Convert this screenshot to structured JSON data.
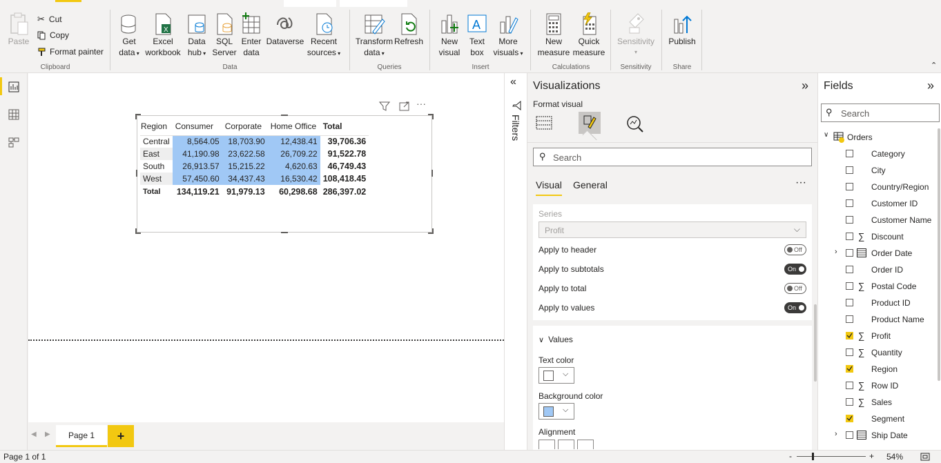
{
  "ribbon": {
    "clipboard": {
      "paste": "Paste",
      "cut": "Cut",
      "copy": "Copy",
      "format_painter": "Format painter",
      "group": "Clipboard"
    },
    "data": {
      "get_data_1": "Get",
      "get_data_2": "data",
      "excel_1": "Excel",
      "excel_2": "workbook",
      "hub_1": "Data",
      "hub_2": "hub",
      "sql_1": "SQL",
      "sql_2": "Server",
      "enter_1": "Enter",
      "enter_2": "data",
      "dataverse": "Dataverse",
      "recent_1": "Recent",
      "recent_2": "sources",
      "group": "Data"
    },
    "queries": {
      "transform_1": "Transform",
      "transform_2": "data",
      "refresh": "Refresh",
      "group": "Queries"
    },
    "insert": {
      "newvis_1": "New",
      "newvis_2": "visual",
      "textbox_1": "Text",
      "textbox_2": "box",
      "more_1": "More",
      "more_2": "visuals",
      "group": "Insert"
    },
    "calc": {
      "newmeasure_1": "New",
      "newmeasure_2": "measure",
      "quick_1": "Quick",
      "quick_2": "measure",
      "group": "Calculations"
    },
    "sensitivity": {
      "label": "Sensitivity",
      "group": "Sensitivity"
    },
    "share": {
      "publish": "Publish",
      "group": "Share"
    }
  },
  "matrix": {
    "headers": [
      "Region",
      "Consumer",
      "Corporate",
      "Home Office",
      "Total"
    ],
    "rows": [
      {
        "region": "Central",
        "consumer": "8,564.05",
        "corporate": "18,703.90",
        "home": "12,438.41",
        "total": "39,706.36"
      },
      {
        "region": "East",
        "consumer": "41,190.98",
        "corporate": "23,622.58",
        "home": "26,709.22",
        "total": "91,522.78"
      },
      {
        "region": "South",
        "consumer": "26,913.57",
        "corporate": "15,215.22",
        "home": "4,620.63",
        "total": "46,749.43"
      },
      {
        "region": "West",
        "consumer": "57,450.60",
        "corporate": "34,437.43",
        "home": "16,530.42",
        "total": "108,418.45"
      }
    ],
    "total_row": {
      "region": "Total",
      "consumer": "134,119.21",
      "corporate": "91,979.13",
      "home": "60,298.68",
      "total": "286,397.02"
    },
    "highlight_color": "#a0c8f5"
  },
  "pages": {
    "page1": "Page 1",
    "add": "+"
  },
  "status": {
    "page_info": "Page 1 of 1",
    "zoom": "54%",
    "zoom_minus": "-",
    "zoom_plus": "+"
  },
  "filters": {
    "label": "Filters"
  },
  "visualizations": {
    "title": "Visualizations",
    "subtitle": "Format visual",
    "search_placeholder": "Search",
    "tabs": [
      "Visual",
      "General"
    ],
    "series_label": "Series",
    "series_value": "Profit",
    "toggles": [
      {
        "label": "Apply to header",
        "state": "Off"
      },
      {
        "label": "Apply to subtotals",
        "state": "On"
      },
      {
        "label": "Apply to total",
        "state": "Off"
      },
      {
        "label": "Apply to values",
        "state": "On"
      }
    ],
    "values_section": "Values",
    "text_color_label": "Text color",
    "bg_color_label": "Background color",
    "alignment_label": "Alignment",
    "text_color": "#ffffff",
    "bg_color": "#a0c8f5"
  },
  "fields": {
    "title": "Fields",
    "search_placeholder": "Search",
    "table_name": "Orders",
    "items": [
      {
        "name": "Category",
        "sigma": false,
        "checked": false,
        "expand": false,
        "calendar": false
      },
      {
        "name": "City",
        "sigma": false,
        "checked": false,
        "expand": false,
        "calendar": false
      },
      {
        "name": "Country/Region",
        "sigma": false,
        "checked": false,
        "expand": false,
        "calendar": false
      },
      {
        "name": "Customer ID",
        "sigma": false,
        "checked": false,
        "expand": false,
        "calendar": false
      },
      {
        "name": "Customer Name",
        "sigma": false,
        "checked": false,
        "expand": false,
        "calendar": false
      },
      {
        "name": "Discount",
        "sigma": true,
        "checked": false,
        "expand": false,
        "calendar": false
      },
      {
        "name": "Order Date",
        "sigma": false,
        "checked": false,
        "expand": true,
        "calendar": true
      },
      {
        "name": "Order ID",
        "sigma": false,
        "checked": false,
        "expand": false,
        "calendar": false
      },
      {
        "name": "Postal Code",
        "sigma": true,
        "checked": false,
        "expand": false,
        "calendar": false
      },
      {
        "name": "Product ID",
        "sigma": false,
        "checked": false,
        "expand": false,
        "calendar": false
      },
      {
        "name": "Product Name",
        "sigma": false,
        "checked": false,
        "expand": false,
        "calendar": false
      },
      {
        "name": "Profit",
        "sigma": true,
        "checked": true,
        "expand": false,
        "calendar": false
      },
      {
        "name": "Quantity",
        "sigma": true,
        "checked": false,
        "expand": false,
        "calendar": false
      },
      {
        "name": "Region",
        "sigma": false,
        "checked": true,
        "expand": false,
        "calendar": false
      },
      {
        "name": "Row ID",
        "sigma": true,
        "checked": false,
        "expand": false,
        "calendar": false
      },
      {
        "name": "Sales",
        "sigma": true,
        "checked": false,
        "expand": false,
        "calendar": false
      },
      {
        "name": "Segment",
        "sigma": false,
        "checked": true,
        "expand": false,
        "calendar": false
      },
      {
        "name": "Ship Date",
        "sigma": false,
        "checked": false,
        "expand": true,
        "calendar": true
      }
    ]
  }
}
